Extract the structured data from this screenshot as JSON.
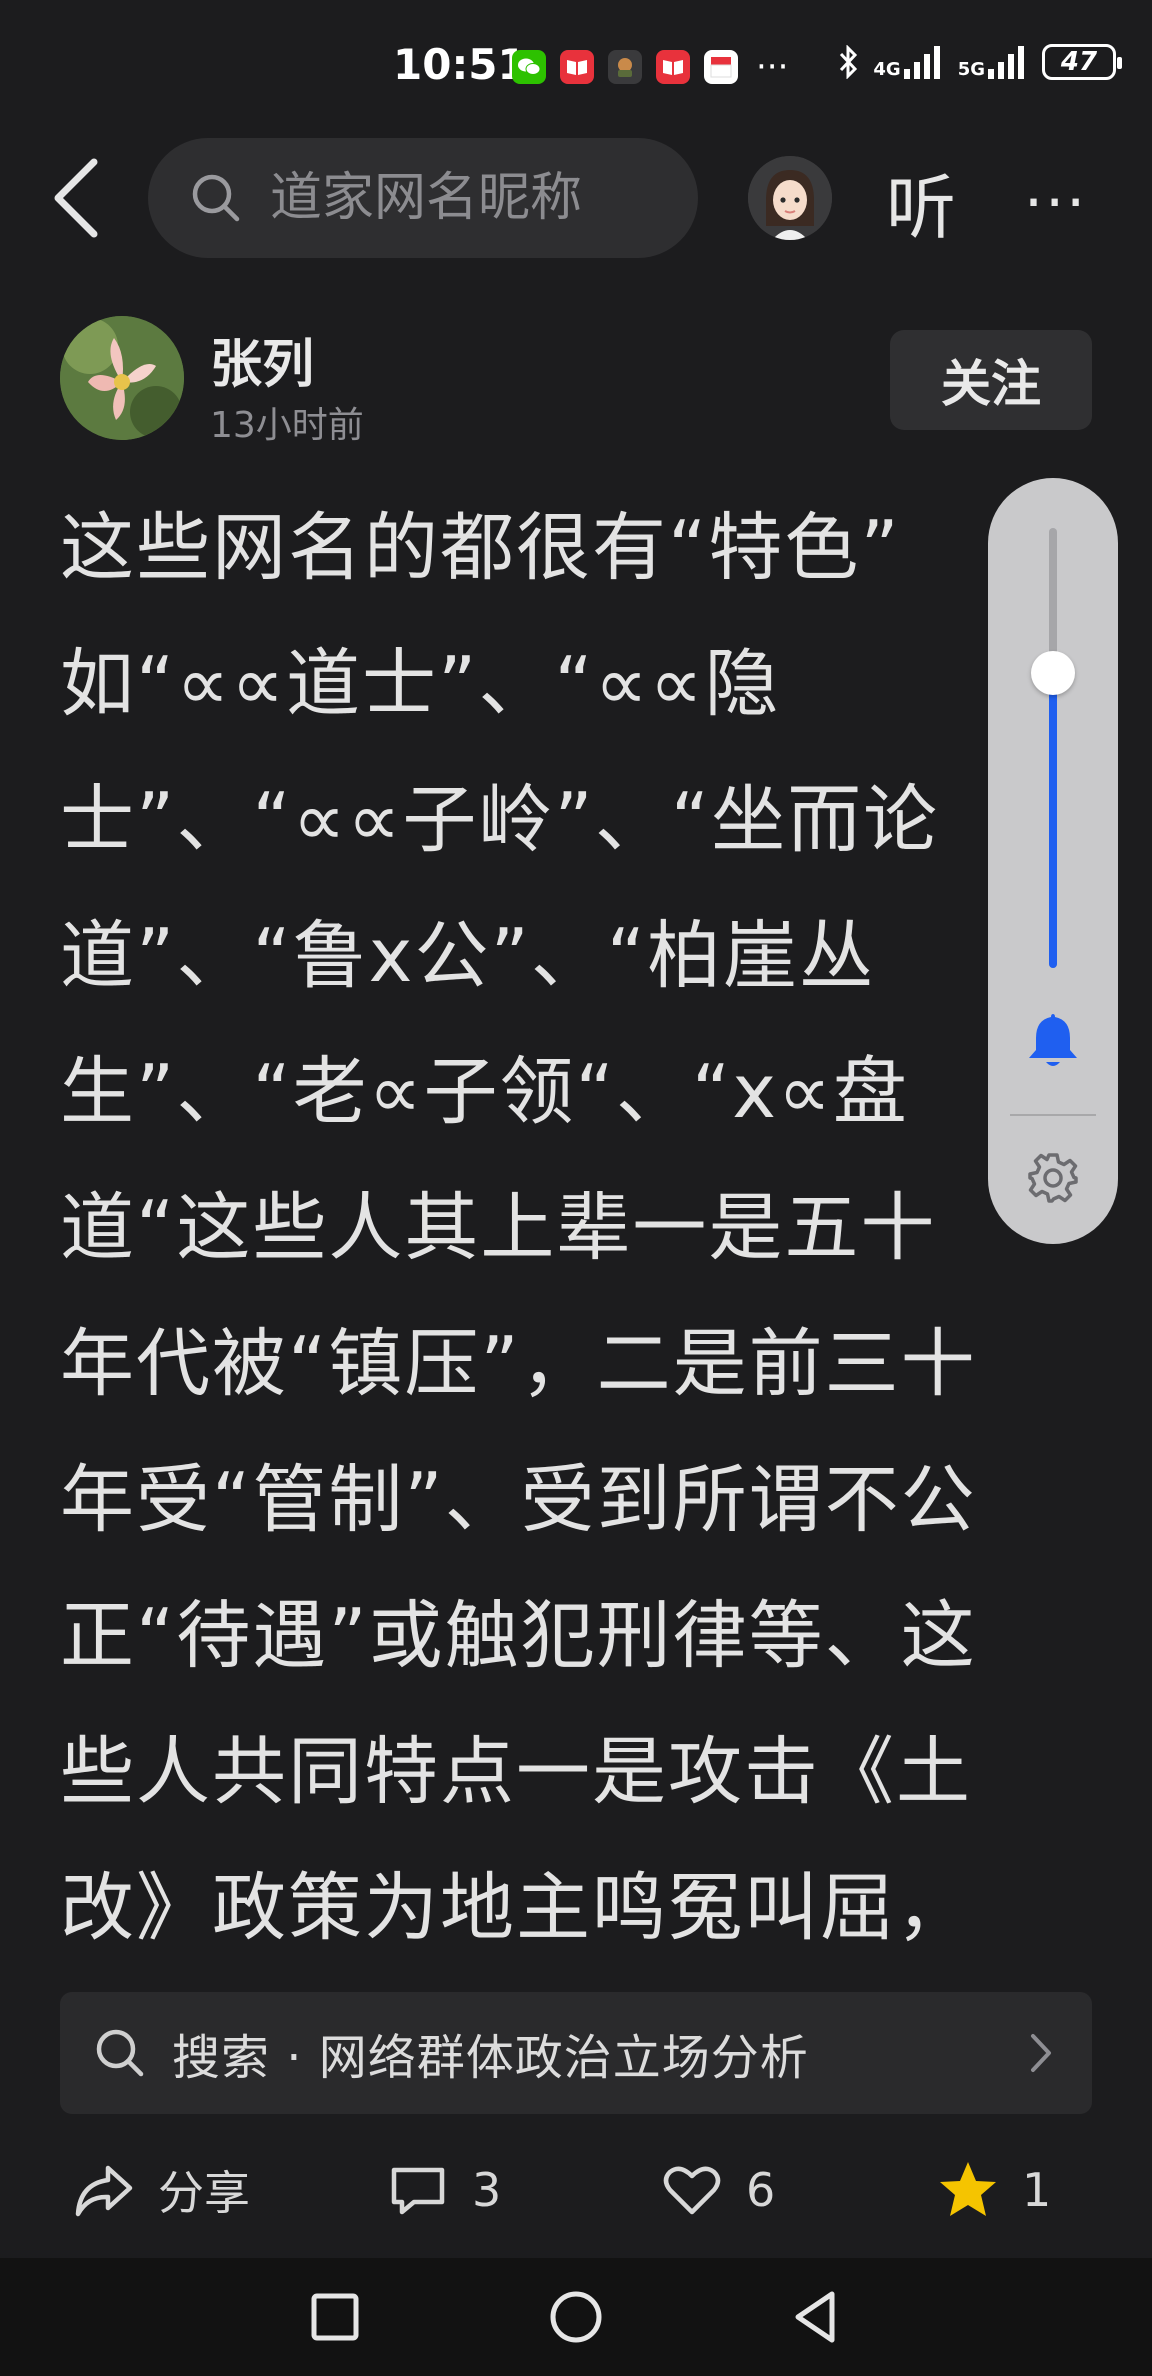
{
  "status_bar": {
    "time": "10:51",
    "network_1": "4G",
    "network_2": "5G",
    "battery": "47"
  },
  "header": {
    "search_placeholder": "道家网名昵称",
    "listen_label": "听",
    "more_label": "···"
  },
  "author": {
    "name": "张列",
    "time": "13小时前",
    "follow_label": "关注"
  },
  "article": {
    "lines": [
      "这些网名的都很有“特色”",
      "如“∝∝道士”、“∝∝隐",
      "士”、“∝∝子岭”、“坐而论",
      "道”、“鲁x公”、“柏崖丛",
      "生”、“老∝子领“、“x∝盘",
      "道“这些人其上辈一是五十",
      "年代被“镇压”，二是前三十",
      "年受“管制”、受到所谓不公",
      "正“待遇”或触犯刑律等、这",
      "些人共同特点一是攻击《土",
      "改》政策为地主鸣冤叫屈，"
    ]
  },
  "volume": {
    "level": 0.67
  },
  "suggestion": {
    "text": "搜索 · 网络群体政治立场分析"
  },
  "actions": {
    "share_label": "分享",
    "comments": "3",
    "likes": "6",
    "favorites": "1"
  },
  "colors": {
    "background": "#1c1c1e",
    "accent_blue": "#1f5ff0",
    "star": "#f5c400"
  }
}
